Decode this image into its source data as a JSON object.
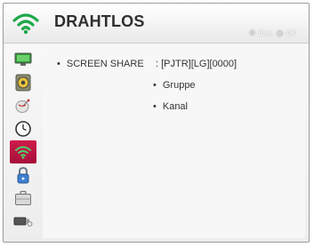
{
  "header": {
    "title": "DRAHTLOS",
    "hint_move": "Bew.",
    "hint_ok": "OK",
    "accent": "#1ea84a"
  },
  "sidebar": {
    "active_color": "#c2143f",
    "items": [
      {
        "icon": "monitor-icon",
        "active": false
      },
      {
        "icon": "speaker-icon",
        "active": false
      },
      {
        "icon": "satellite-dish-icon",
        "active": false
      },
      {
        "icon": "clock-icon",
        "active": false
      },
      {
        "icon": "wireless-icon",
        "active": true
      },
      {
        "icon": "lock-icon",
        "active": false
      },
      {
        "icon": "briefcase-icon",
        "active": false
      },
      {
        "icon": "usb-device-icon",
        "active": false
      }
    ]
  },
  "content": {
    "screen_share_label": "SCREEN SHARE",
    "screen_share_value": ": [PJTR][LG][0000]",
    "group_label": "Gruppe",
    "channel_label": "Kanal"
  }
}
